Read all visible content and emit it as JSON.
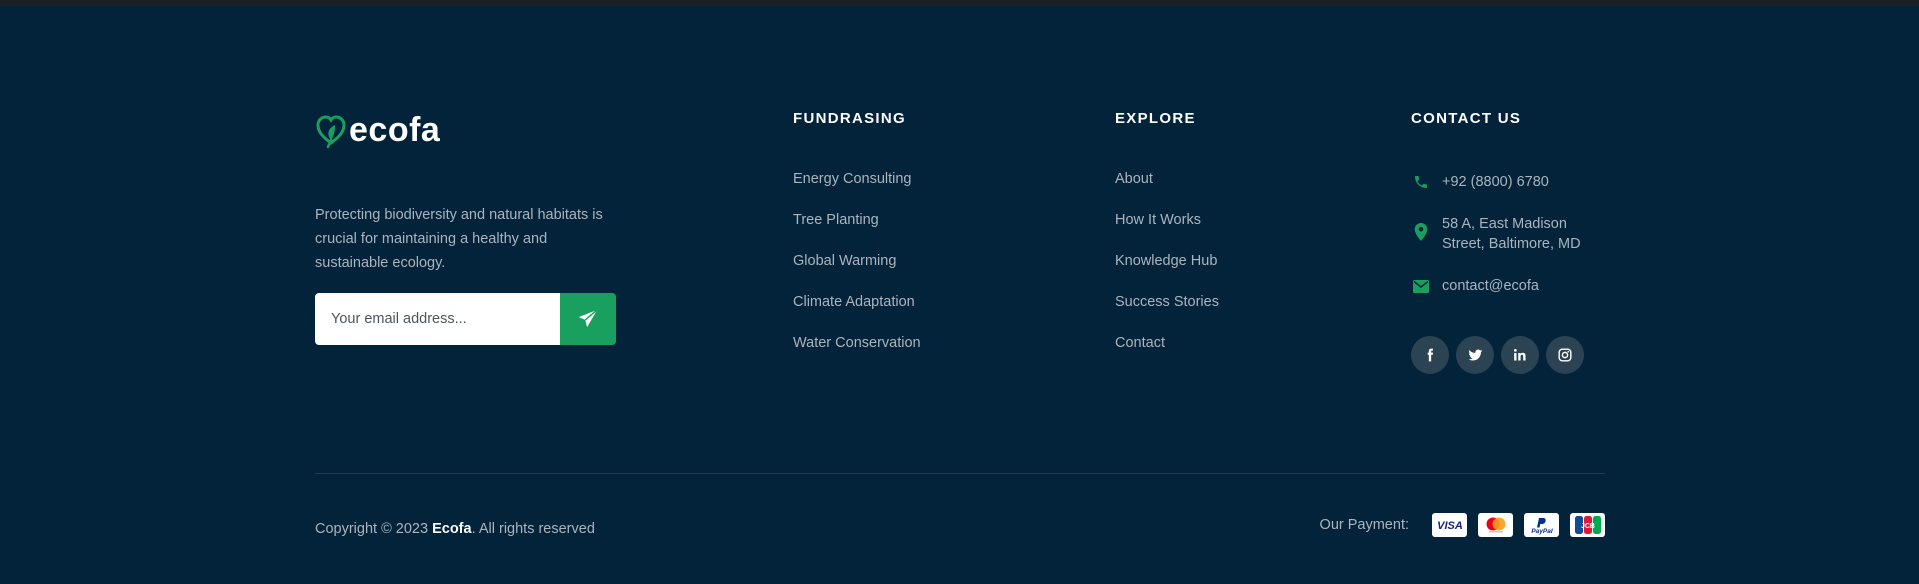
{
  "brand": {
    "name": "ecofa"
  },
  "about": {
    "text": "Protecting biodiversity and natural habitats is crucial for maintaining a healthy and sustainable ecology."
  },
  "newsletter": {
    "placeholder": "Your email address..."
  },
  "fundraising": {
    "heading": "FUNDRASING",
    "links": [
      "Energy Consulting",
      "Tree Planting",
      "Global Warming",
      "Climate Adaptation",
      "Water Conservation"
    ]
  },
  "explore": {
    "heading": "EXPLORE",
    "links": [
      "About",
      "How It Works",
      "Knowledge Hub",
      "Success Stories",
      "Contact"
    ]
  },
  "contact": {
    "heading": "CONTACT US",
    "phone": "+92 (8800) 6780",
    "address_line1": "58 A, East Madison",
    "address_line2": "Street, Baltimore, MD",
    "email": "contact@ecofa"
  },
  "socials": [
    "facebook-icon",
    "twitter-icon",
    "linkedin-icon",
    "instagram-icon"
  ],
  "copyright": {
    "prefix": "Copyright © 2023 ",
    "brand": "Ecofa",
    "suffix": ". All rights reserved"
  },
  "payment": {
    "label": "Our Payment:",
    "cards": [
      "VISA",
      "Mastercard",
      "PayPal",
      "JCB"
    ]
  },
  "colors": {
    "background": "#03233a",
    "accent": "#1aa05e",
    "text": "#aab4bd",
    "heading": "#ffffff"
  }
}
